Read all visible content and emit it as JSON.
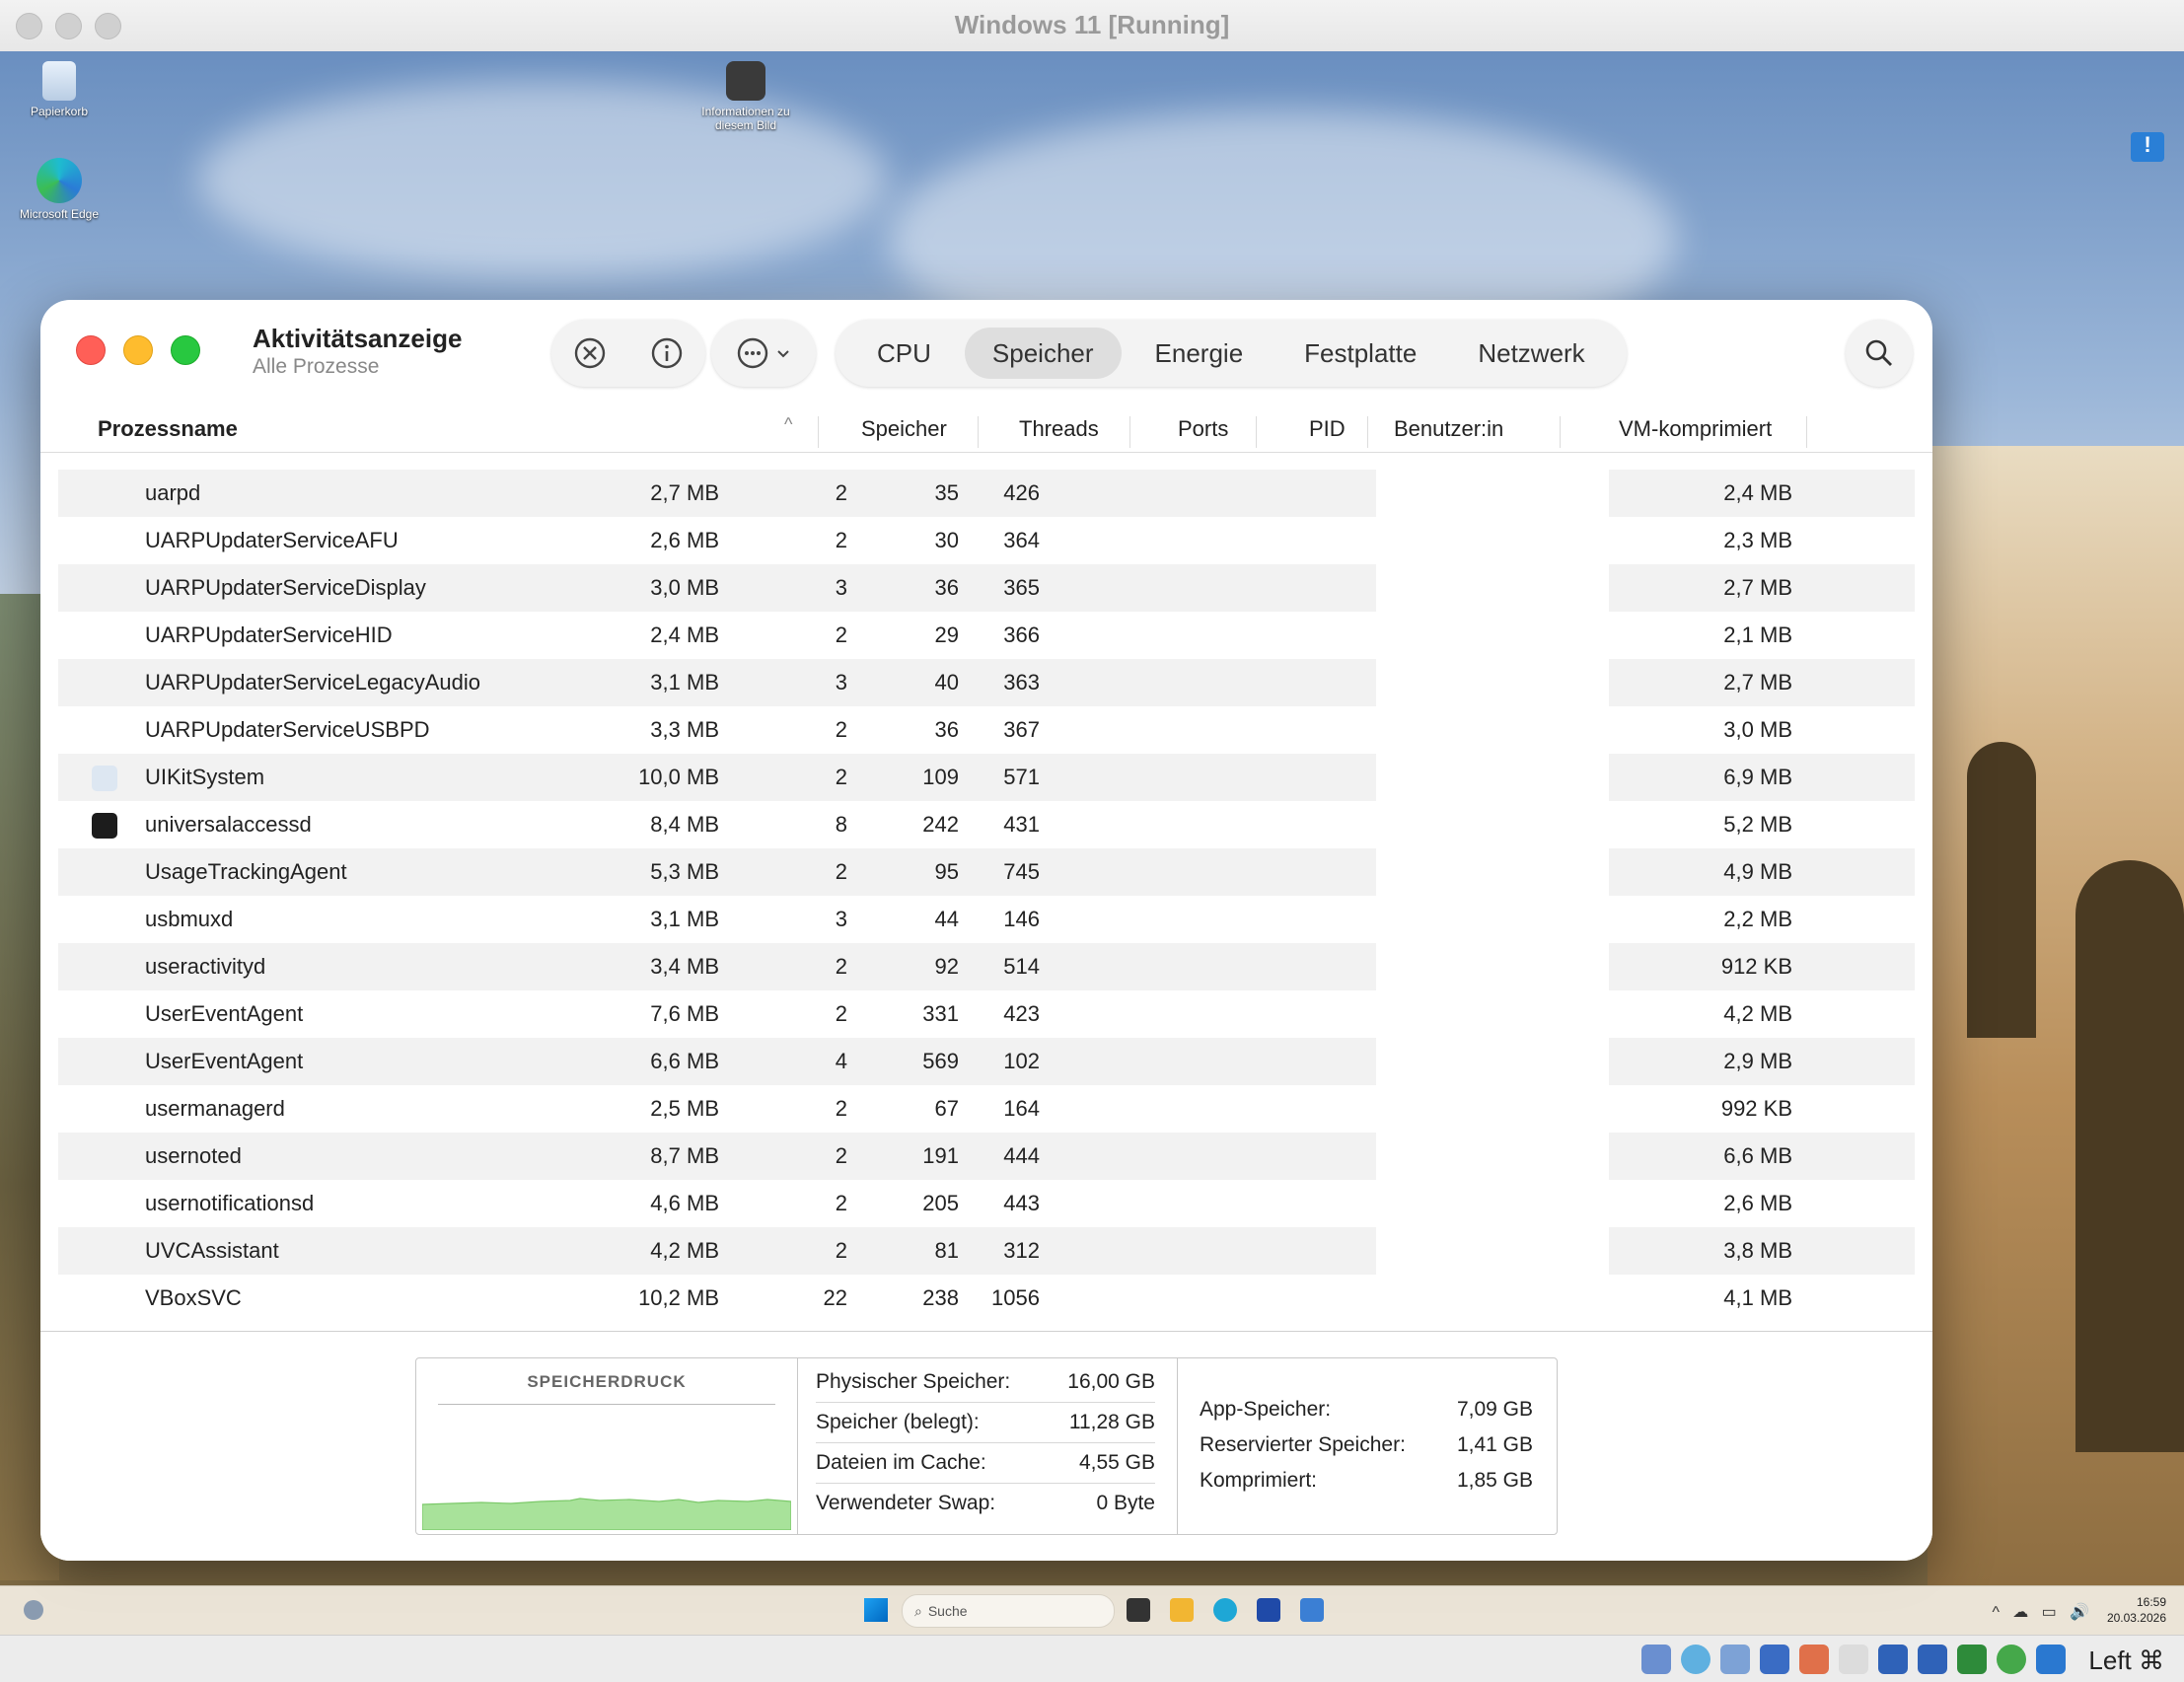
{
  "host": {
    "title": "Windows 11 [Running]",
    "status_text": "Left ⌘"
  },
  "desktop": {
    "icons": [
      {
        "label": "Papierkorb"
      },
      {
        "label": "Microsoft Edge"
      },
      {
        "label": "Informationen zu diesem Bild"
      }
    ]
  },
  "taskbar": {
    "search_placeholder": "Suche",
    "time": "16:59",
    "date": "20.03.2026"
  },
  "activity_monitor": {
    "title": "Aktivitätsanzeige",
    "subtitle": "Alle Prozesse",
    "tabs": [
      {
        "label": "CPU"
      },
      {
        "label": "Speicher",
        "active": true
      },
      {
        "label": "Energie"
      },
      {
        "label": "Festplatte"
      },
      {
        "label": "Netzwerk"
      }
    ],
    "columns": {
      "name": "Prozessname",
      "memory": "Speicher",
      "threads": "Threads",
      "ports": "Ports",
      "pid": "PID",
      "user": "Benutzer:in",
      "vm": "VM-komprimiert"
    },
    "rows": [
      {
        "name": "uarpd",
        "memory": "2,7 MB",
        "threads": "2",
        "ports": "35",
        "pid": "426",
        "vm": "2,4 MB"
      },
      {
        "name": "UARPUpdaterServiceAFU",
        "memory": "2,6 MB",
        "threads": "2",
        "ports": "30",
        "pid": "364",
        "vm": "2,3 MB"
      },
      {
        "name": "UARPUpdaterServiceDisplay",
        "memory": "3,0 MB",
        "threads": "3",
        "ports": "36",
        "pid": "365",
        "vm": "2,7 MB"
      },
      {
        "name": "UARPUpdaterServiceHID",
        "memory": "2,4 MB",
        "threads": "2",
        "ports": "29",
        "pid": "366",
        "vm": "2,1 MB"
      },
      {
        "name": "UARPUpdaterServiceLegacyAudio",
        "memory": "3,1 MB",
        "threads": "3",
        "ports": "40",
        "pid": "363",
        "vm": "2,7 MB"
      },
      {
        "name": "UARPUpdaterServiceUSBPD",
        "memory": "3,3 MB",
        "threads": "2",
        "ports": "36",
        "pid": "367",
        "vm": "3,0 MB"
      },
      {
        "name": "UIKitSystem",
        "memory": "10,0 MB",
        "threads": "2",
        "ports": "109",
        "pid": "571",
        "vm": "6,9 MB",
        "icon": "uikit-icon"
      },
      {
        "name": "universalaccessd",
        "memory": "8,4 MB",
        "threads": "8",
        "ports": "242",
        "pid": "431",
        "vm": "5,2 MB",
        "icon": "terminal-icon"
      },
      {
        "name": "UsageTrackingAgent",
        "memory": "5,3 MB",
        "threads": "2",
        "ports": "95",
        "pid": "745",
        "vm": "4,9 MB"
      },
      {
        "name": "usbmuxd",
        "memory": "3,1 MB",
        "threads": "3",
        "ports": "44",
        "pid": "146",
        "vm": "2,2 MB"
      },
      {
        "name": "useractivityd",
        "memory": "3,4 MB",
        "threads": "2",
        "ports": "92",
        "pid": "514",
        "vm": "912 KB"
      },
      {
        "name": "UserEventAgent",
        "memory": "7,6 MB",
        "threads": "2",
        "ports": "331",
        "pid": "423",
        "vm": "4,2 MB"
      },
      {
        "name": "UserEventAgent",
        "memory": "6,6 MB",
        "threads": "4",
        "ports": "569",
        "pid": "102",
        "vm": "2,9 MB"
      },
      {
        "name": "usermanagerd",
        "memory": "2,5 MB",
        "threads": "2",
        "ports": "67",
        "pid": "164",
        "vm": "992 KB"
      },
      {
        "name": "usernoted",
        "memory": "8,7 MB",
        "threads": "2",
        "ports": "191",
        "pid": "444",
        "vm": "6,6 MB"
      },
      {
        "name": "usernotificationsd",
        "memory": "4,6 MB",
        "threads": "2",
        "ports": "205",
        "pid": "443",
        "vm": "2,6 MB"
      },
      {
        "name": "UVCAssistant",
        "memory": "4,2 MB",
        "threads": "2",
        "ports": "81",
        "pid": "312",
        "vm": "3,8 MB"
      },
      {
        "name": "VBoxSVC",
        "memory": "10,2 MB",
        "threads": "22",
        "ports": "238",
        "pid": "1056",
        "vm": "4,1 MB"
      }
    ],
    "memory_panel": {
      "pressure_title": "SPEICHERDRUCK",
      "stats_left": [
        {
          "label": "Physischer Speicher:",
          "value": "16,00 GB"
        },
        {
          "label": "Speicher (belegt):",
          "value": "11,28 GB"
        },
        {
          "label": "Dateien im Cache:",
          "value": "4,55 GB"
        },
        {
          "label": "Verwendeter Swap:",
          "value": "0 Byte"
        }
      ],
      "stats_right": [
        {
          "label": "App-Speicher:",
          "value": "7,09 GB"
        },
        {
          "label": "Reservierter Speicher:",
          "value": "1,41 GB"
        },
        {
          "label": "Komprimiert:",
          "value": "1,85 GB"
        }
      ],
      "pressure_color": "#a8e29a"
    }
  }
}
